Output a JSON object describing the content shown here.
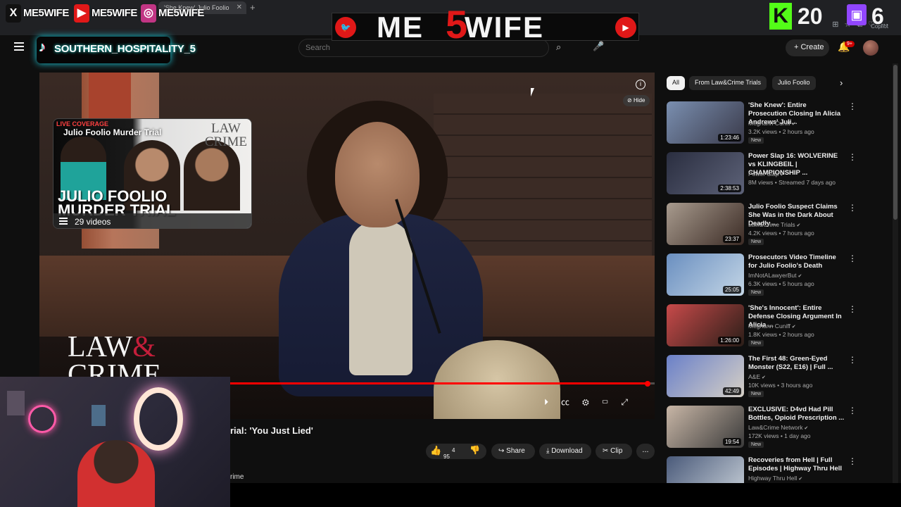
{
  "browser": {
    "tab_title": "'She Knew' Julio Foolio",
    "copilot_label": "Copilot"
  },
  "youtube": {
    "search_placeholder": "Search",
    "create_label": "Create",
    "notification_badge": "9+"
  },
  "player": {
    "watermark_top": "LAW\nCRIME",
    "watermark_big_law": "LAW",
    "watermark_big_amp": "&",
    "watermark_big_crime": "CRIME",
    "hide_label": "Hide",
    "info_label": "i",
    "progress_fraction": 0.989
  },
  "playlist_card": {
    "live_label": "LIVE COVERAGE",
    "title": "Julio Foolio Murder Trial",
    "brand": "LAW\nCRIME",
    "big_text": "JULIO FOOLIO\nMURDER TRIAL",
    "count": "29 videos"
  },
  "video": {
    "title_fragment": "rial: 'You Just Lied'",
    "channel_fragment": "rime",
    "likes": "95",
    "likes_sup": "4",
    "share_label": "Share",
    "download_label": "Download",
    "clip_label": "Clip",
    "more_label": "..."
  },
  "chips": [
    {
      "label": "All",
      "active": true
    },
    {
      "label": "From Law&Crime Trials",
      "active": false
    },
    {
      "label": "Julio Foolio",
      "active": false
    }
  ],
  "recommendations": [
    {
      "title": "'She Knew': Entire Prosecution Closing In Alicia Andrews' Juli...",
      "channel": "Meghann Cuniff",
      "meta": "3.2K views • 2 hours ago",
      "new": "New",
      "duration": "1:23:46",
      "colors": [
        "#7a8fb0",
        "#3a3a4a"
      ]
    },
    {
      "title": "Power Slap 16: WOLVERINE vs KLINGBEIL | CHAMPIONSHIP ...",
      "channel": "Power Slap",
      "meta": "8M views • Streamed 7 days ago",
      "new": "",
      "duration": "2:38:53",
      "colors": [
        "#2a2e40",
        "#5d6278"
      ]
    },
    {
      "title": "Julio Foolio Suspect Claims She Was in the Dark About Deadly ...",
      "channel": "Law&Crime Trials",
      "meta": "4.2K views • 7 hours ago",
      "new": "New",
      "duration": "23:37",
      "colors": [
        "#a89b8e",
        "#3b2b25"
      ]
    },
    {
      "title": "Prosecutors Video Timeline for Julio Foolio's Death",
      "channel": "ImNotALawyerBut",
      "meta": "6.3K views • 5 hours ago",
      "new": "New",
      "duration": "25:05",
      "colors": [
        "#6a8fc0",
        "#c4d6e6"
      ]
    },
    {
      "title": "'She's Innocent': Entire Defense Closing Argument In Alicia ...",
      "channel": "Meghann Cuniff",
      "meta": "1.8K views • 2 hours ago",
      "new": "New",
      "duration": "1:26:00",
      "colors": [
        "#c84a4a",
        "#2a1e18"
      ]
    },
    {
      "title": "The First 48: Green-Eyed Monster (S22, E16) | Full ...",
      "channel": "A&E",
      "meta": "10K views • 3 hours ago",
      "new": "New",
      "duration": "42:49",
      "colors": [
        "#6a80c8",
        "#d6d0c6"
      ]
    },
    {
      "title": "EXCLUSIVE: D4vd Had Pill Bottles, Opioid Prescription ...",
      "channel": "Law&Crime Network",
      "meta": "172K views • 1 day ago",
      "new": "New",
      "duration": "19:54",
      "colors": [
        "#c8b6a6",
        "#3a3a3a"
      ]
    },
    {
      "title": "Recoveries from Hell | Full Episodes | Highway Thru Hell",
      "channel": "Highway Thru Hell",
      "meta": "",
      "new": "",
      "duration": "",
      "colors": [
        "#4a5a7a",
        "#c8d0d8"
      ]
    }
  ],
  "overlay": {
    "socials": [
      {
        "icon": "X",
        "handle": "ME5WIFE",
        "color": "#111111"
      },
      {
        "icon": "▶",
        "handle": "ME5WIFE",
        "color": "#e01818"
      },
      {
        "icon": "◎",
        "handle": "ME5WIFE",
        "color": "#c13584"
      }
    ],
    "tiktok_handle": "SOUTHERN_HOSPITALITY_5",
    "brand_left": "ME",
    "brand_five": "5",
    "brand_right": "WIFE",
    "kick_count": "20",
    "twitch_count": "6"
  }
}
